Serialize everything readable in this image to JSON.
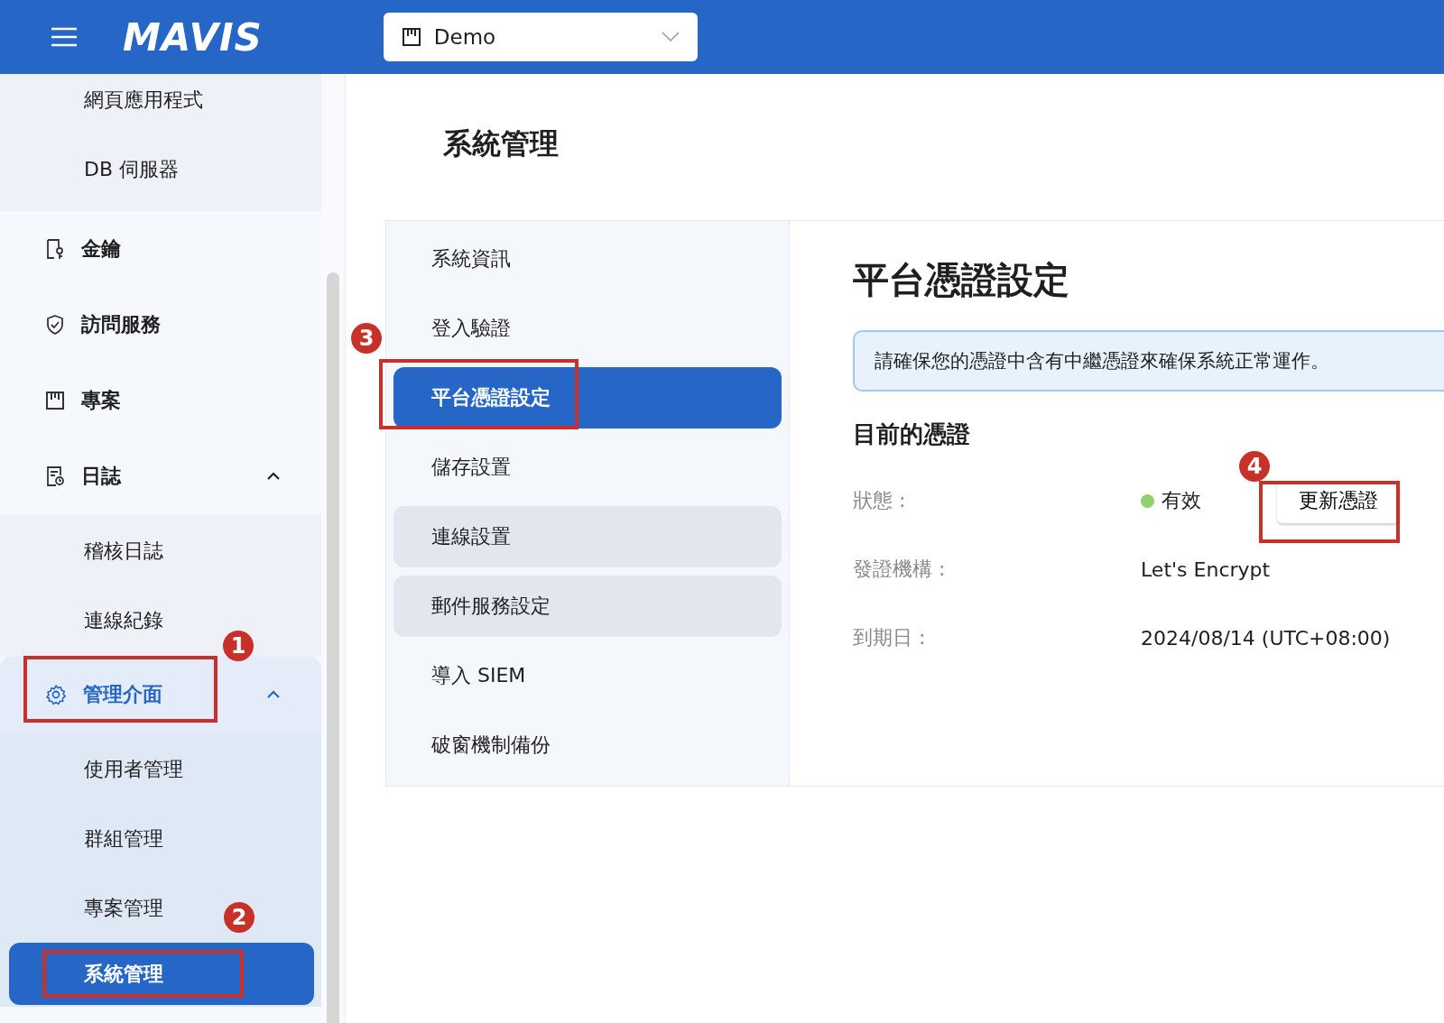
{
  "header": {
    "logo": "MAVIS",
    "project_selector": {
      "value": "Demo"
    }
  },
  "sidebar": {
    "items": [
      {
        "kind": "continued",
        "children": [
          {
            "label": "網頁應用程式",
            "selected": false
          },
          {
            "label": "DB 伺服器",
            "selected": false
          }
        ]
      },
      {
        "kind": "link",
        "label": "金鑰",
        "active": false
      },
      {
        "kind": "link",
        "label": "訪問服務",
        "active": false
      },
      {
        "kind": "link",
        "label": "專案",
        "active": false
      },
      {
        "kind": "group",
        "label": "日誌",
        "active": false,
        "expanded": true,
        "children": [
          {
            "label": "稽核日誌",
            "selected": false
          },
          {
            "label": "連線紀錄",
            "selected": false
          }
        ]
      },
      {
        "kind": "group",
        "label": "管理介面",
        "active": true,
        "expanded": true,
        "children": [
          {
            "label": "使用者管理",
            "selected": false
          },
          {
            "label": "群組管理",
            "selected": false
          },
          {
            "label": "專案管理",
            "selected": false
          },
          {
            "label": "系統管理",
            "selected": true
          }
        ]
      }
    ]
  },
  "page": {
    "title": "系統管理"
  },
  "settings_nav": [
    {
      "label": "系統資訊",
      "selected": false,
      "hovered": false
    },
    {
      "label": "登入驗證",
      "selected": false,
      "hovered": false
    },
    {
      "label": "平台憑證設定",
      "selected": true,
      "hovered": false
    },
    {
      "label": "儲存設置",
      "selected": false,
      "hovered": false
    },
    {
      "label": "連線設置",
      "selected": false,
      "hovered": true
    },
    {
      "label": "郵件服務設定",
      "selected": false,
      "hovered": true
    },
    {
      "label": "導入 SIEM",
      "selected": false,
      "hovered": false
    },
    {
      "label": "破窗機制備份",
      "selected": false,
      "hovered": false
    }
  ],
  "panel": {
    "title": "平台憑證設定",
    "notice": "請確保您的憑證中含有中繼憑證來確保系統正常運作。",
    "section_title": "目前的憑證",
    "fields": [
      {
        "kind": "status",
        "label": "狀態 :",
        "value": "有效",
        "color": "#8fd16a",
        "button": "更新憑證"
      },
      {
        "kind": "text",
        "label": "發證機構 :",
        "value": "Let's Encrypt"
      },
      {
        "kind": "text",
        "label": "到期日 :",
        "value": "2024/08/14 (UTC+08:00)"
      }
    ]
  },
  "annotations": [
    {
      "number": "1"
    },
    {
      "number": "2"
    },
    {
      "number": "3"
    },
    {
      "number": "4"
    }
  ]
}
